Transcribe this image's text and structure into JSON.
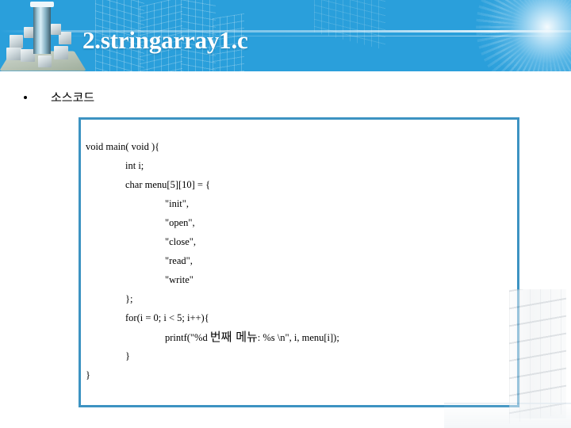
{
  "slide": {
    "title": "2.stringarray1.c",
    "bullet": {
      "marker": "bullet-dot",
      "text": "소스코드"
    },
    "accent_color": "#2a9fdb",
    "border_color": "#3d93c2",
    "code_box": {
      "language": "c",
      "lines": [
        "void main( void ){",
        "                int i;",
        "                char menu[5][10] = {",
        "                                \"init\",",
        "                                \"open\",",
        "                                \"close\",",
        "                                \"read\",",
        "                                \"write\"",
        "                };",
        "                for(i = 0; i < 5; i++){",
        "                }",
        "}"
      ],
      "printf_line": {
        "prefix": "                                printf(\"%d ",
        "korean": "번째 메뉴",
        "suffix": ": %s \\n\", i, menu[i]);"
      }
    },
    "decor": {
      "header_illustration": "3d-city-buildings",
      "header_glow": "sun-glow",
      "footer_watermark": "faint-building"
    }
  }
}
